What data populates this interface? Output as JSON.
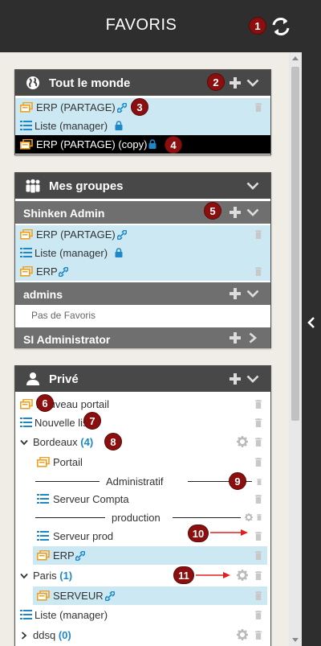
{
  "header": {
    "title": "FAVORIS"
  },
  "markers": [
    "1",
    "2",
    "3",
    "4",
    "5",
    "6",
    "7",
    "8",
    "9",
    "10",
    "11"
  ],
  "panel_public": {
    "title": "Tout le monde",
    "items": [
      {
        "label": "ERP (PARTAGE)"
      },
      {
        "label": "Liste (manager)"
      },
      {
        "label": "ERP (PARTAGE) (copy)"
      }
    ]
  },
  "panel_groups": {
    "title": "Mes groupes",
    "groups": [
      {
        "name": "Shinken Admin",
        "items": [
          {
            "label": "ERP (PARTAGE)"
          },
          {
            "label": "Liste (manager)"
          },
          {
            "label": "ERP"
          }
        ]
      },
      {
        "name": "admins",
        "empty": "Pas de Favoris"
      },
      {
        "name": "SI Administrator"
      }
    ]
  },
  "panel_private": {
    "title": "Privé",
    "items": {
      "new_portal": "Nouveau portail",
      "new_list": "Nouvelle liste",
      "bordeaux": "Bordeaux",
      "bordeaux_count": "(4)",
      "portail": "Portail",
      "sep_admin": "Administratif",
      "serveur_compta": "Serveur Compta",
      "sep_prod": "production",
      "serveur_prod": "Serveur prod",
      "erp": "ERP",
      "paris": "Paris",
      "paris_count": "(1)",
      "serveur": "SERVEUR",
      "liste_manager": "Liste (manager)",
      "ddsq": "ddsq",
      "ddsq_count": "(0)"
    }
  },
  "colors": {
    "accent_blue": "#1e88c7",
    "marker_red": "#8b0f0f",
    "portal_orange": "#f0a020",
    "highlight_row": "#cce9f3"
  }
}
